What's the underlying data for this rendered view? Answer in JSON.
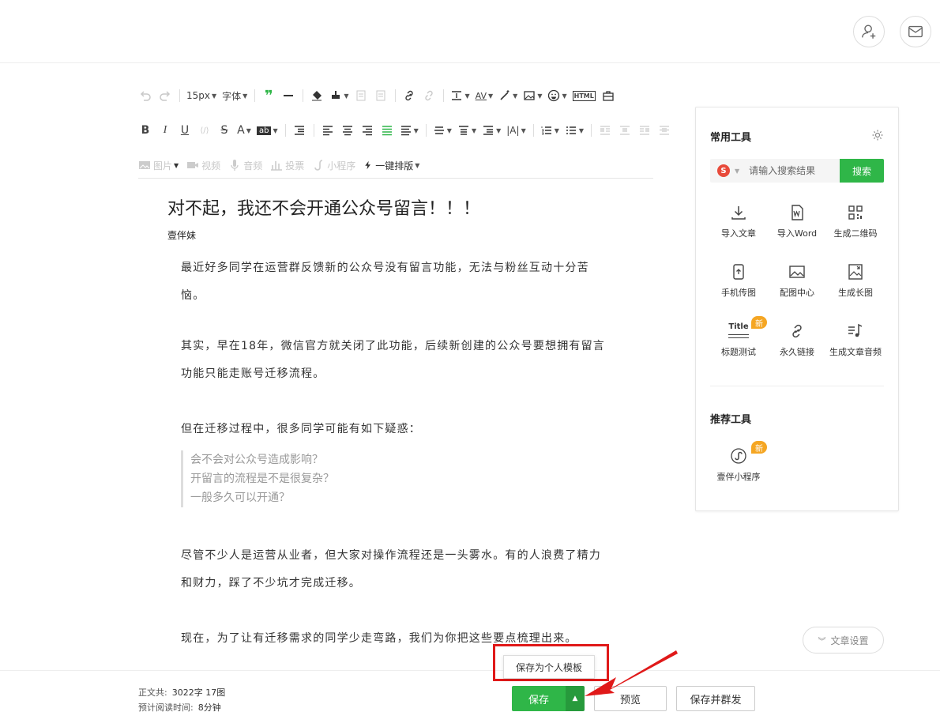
{
  "toolbar": {
    "font_size": "15px",
    "font_family": "字体",
    "html_label": "HTML",
    "media": {
      "image": "图片",
      "video": "视频",
      "audio": "音频",
      "vote": "投票",
      "miniprogram": "小程序",
      "one_click": "一键排版"
    }
  },
  "article": {
    "title": "对不起，我还不会开通公众号留言！！！",
    "author": "壹伴妹",
    "p1": "最近好多同学在运营群反馈新的公众号没有留言功能，无法与粉丝互动十分苦恼。",
    "p2": "其实，早在18年，微信官方就关闭了此功能，后续新创建的公众号要想拥有留言功能只能走账号迁移流程。",
    "p3": "但在迁移过程中，很多同学可能有如下疑惑：",
    "quote": [
      "会不会对公众号造成影响？",
      "开留言的流程是不是很复杂？",
      "一般多久可以开通？"
    ],
    "p4": "尽管不少人是运营从业者，但大家对操作流程还是一头雾水。有的人浪费了精力和财力，踩了不少坑才完成迁移。",
    "p5": "现在，为了让有迁移需求的同学少走弯路，我们为你把这些要点梳理出来。"
  },
  "panel": {
    "common_title": "常用工具",
    "search_placeholder": "请输入搜索结果",
    "search_button": "搜索",
    "search_engine_letter": "S",
    "tools": [
      {
        "label": "导入文章",
        "icon": "download-icon"
      },
      {
        "label": "导入Word",
        "icon": "word-icon"
      },
      {
        "label": "生成二维码",
        "icon": "qrcode-icon"
      },
      {
        "label": "手机传图",
        "icon": "phone-upload-icon"
      },
      {
        "label": "配图中心",
        "icon": "image-icon"
      },
      {
        "label": "生成长图",
        "icon": "long-image-icon"
      },
      {
        "label": "标题测试",
        "icon": "title-icon",
        "icon_text": "Title",
        "badge": "新"
      },
      {
        "label": "永久链接",
        "icon": "link-icon"
      },
      {
        "label": "生成文章音频",
        "icon": "music-icon"
      }
    ],
    "recommend_title": "推荐工具",
    "recommend": [
      {
        "label": "壹伴小程序",
        "icon": "miniprogram-icon",
        "badge": "新"
      }
    ]
  },
  "article_settings": "文章设置",
  "bottom": {
    "word_label": "正文共:",
    "word_value": "3022字 17图",
    "read_label": "预计阅读时间:",
    "read_value": "8分钟",
    "save": "保存",
    "preview": "预览",
    "save_send": "保存并群发",
    "template_tip": "保存为个人模板"
  },
  "colors": {
    "accent_green": "#2fb648",
    "highlight_red": "#e01919",
    "badge_orange": "#f5a623"
  }
}
